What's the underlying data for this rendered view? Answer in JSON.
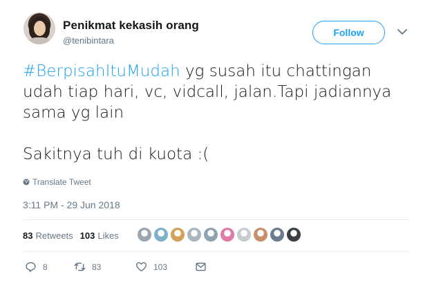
{
  "user": {
    "display_name": "Penikmat kekasih orang",
    "handle": "@tenibintara"
  },
  "follow_label": "Follow",
  "tweet": {
    "hashtag": "#BerpisahItuMudah",
    "line1_rest": " yg susah itu chattingan",
    "line2": "udah tiap hari, vc, vidcall, jalan.Tapi jadiannya",
    "line3": "sama yg lain",
    "line4": "Sakitnya tuh di kuota :("
  },
  "translate_label": "Translate Tweet",
  "timestamp": "3:11 PM - 29 Jun 2018",
  "stats": {
    "retweets_count": "83",
    "retweets_label": "Retweets",
    "likes_count": "103",
    "likes_label": "Likes"
  },
  "likers_colors": [
    "#9aa5ad",
    "#7fb0c9",
    "#d3a15a",
    "#aab6c0",
    "#8ea2b0",
    "#e07aa8",
    "#c5ccd2",
    "#c98f6a",
    "#6a7c8e",
    "#3b3f44"
  ],
  "actions": {
    "replies": "8",
    "retweets": "83",
    "likes": "103"
  },
  "colors": {
    "accent": "#1da1f2",
    "secondary_text": "#657786"
  }
}
